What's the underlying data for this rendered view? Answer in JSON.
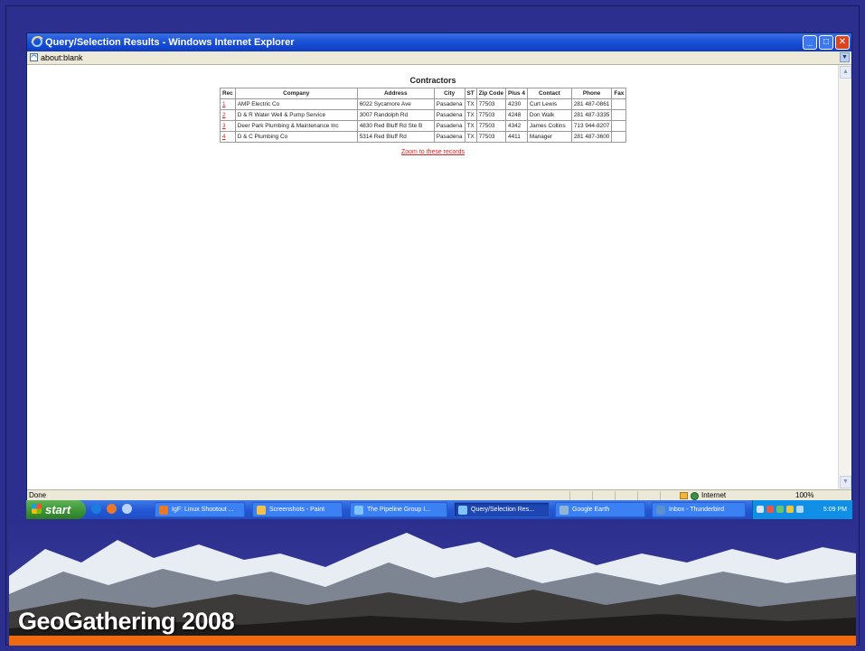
{
  "window": {
    "title": "Query/Selection Results - Windows Internet Explorer",
    "address": "about:blank",
    "status": "Done",
    "zone": "Internet",
    "zoom": "100%"
  },
  "results": {
    "title": "Contractors",
    "columns": [
      "Rec",
      "Company",
      "Address",
      "City",
      "ST",
      "Zip Code",
      "Plus 4",
      "Contact",
      "Phone",
      "Fax"
    ],
    "rows": [
      {
        "rec": "1",
        "company": "AMP Electric Co",
        "address": "6022 Sycamore Ave",
        "city": "Pasadena",
        "st": "TX",
        "zip": "77503",
        "plus4": "4230",
        "contact": "Curt Lewis",
        "phone": "281 487-0861",
        "fax": ""
      },
      {
        "rec": "2",
        "company": "D & R Water Well & Pump Service",
        "address": "3007 Randolph Rd",
        "city": "Pasadena",
        "st": "TX",
        "zip": "77503",
        "plus4": "4248",
        "contact": "Don Walk",
        "phone": "281 487-3335",
        "fax": ""
      },
      {
        "rec": "3",
        "company": "Deer Park Plumbing & Maintenance Inc",
        "address": "4830 Red Bluff Rd Ste B",
        "city": "Pasadena",
        "st": "TX",
        "zip": "77503",
        "plus4": "4342",
        "contact": "James Collins",
        "phone": "713 944-8207",
        "fax": ""
      },
      {
        "rec": "4",
        "company": "D & C Plumbing Co",
        "address": "5314 Red Bluff Rd",
        "city": "Pasadena",
        "st": "TX",
        "zip": "77503",
        "plus4": "4411",
        "contact": "Manager",
        "phone": "281 487-3600",
        "fax": ""
      }
    ],
    "zoom_link": "Zoom to these records"
  },
  "taskbar": {
    "start_label": "start",
    "tasks": [
      "IgF: Linux Shootout ...",
      "Screenshots - Paint",
      "The Pipeline Group I...",
      "Query/Selection Res...",
      "Google Earth",
      "Inbox - Thunderbird"
    ],
    "clock": "5:09 PM"
  },
  "footer": {
    "title": "GeoGathering 2008"
  }
}
